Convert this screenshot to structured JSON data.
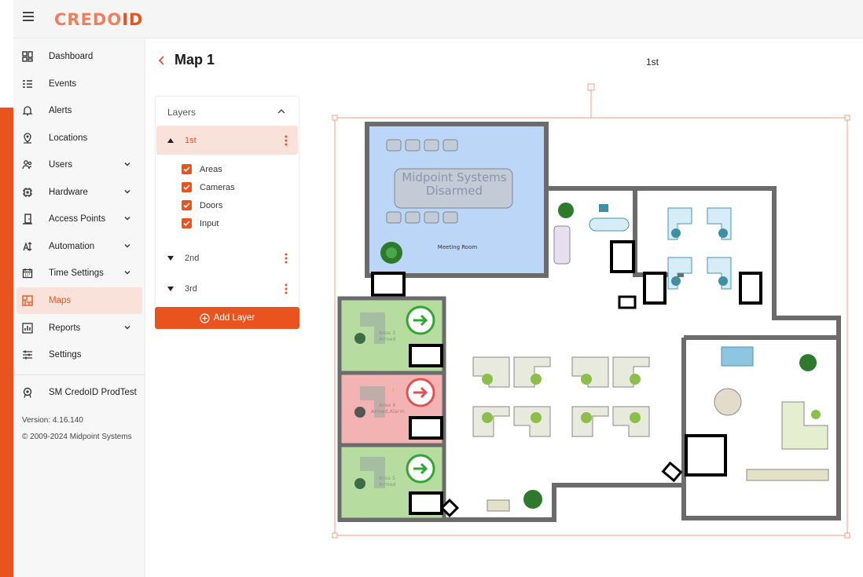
{
  "brand": {
    "logo_part1": "CREDO",
    "logo_part2": "ID"
  },
  "sidebar": {
    "items": [
      {
        "label": "Dashboard"
      },
      {
        "label": "Events"
      },
      {
        "label": "Alerts"
      },
      {
        "label": "Locations"
      },
      {
        "label": "Users"
      },
      {
        "label": "Hardware"
      },
      {
        "label": "Access Points"
      },
      {
        "label": "Automation"
      },
      {
        "label": "Time Settings"
      },
      {
        "label": "Maps"
      },
      {
        "label": "Reports"
      },
      {
        "label": "Settings"
      }
    ],
    "tenant": "SM CredoID ProdTest",
    "version": "Version: 4.16.140",
    "copyright": "© 2009-2024 Midpoint Systems"
  },
  "page": {
    "title": "Map 1"
  },
  "layers_panel": {
    "title": "Layers",
    "layers": [
      {
        "name": "1st"
      },
      {
        "name": "2nd"
      },
      {
        "name": "3rd"
      }
    ],
    "filters": [
      {
        "label": "Areas",
        "checked": true
      },
      {
        "label": "Cameras",
        "checked": true
      },
      {
        "label": "Doors",
        "checked": true
      },
      {
        "label": "Input",
        "checked": true
      }
    ],
    "add_button": "Add Layer"
  },
  "map": {
    "layer_label": "1st",
    "meeting_room": {
      "status_line1": "Midpoint Systems",
      "status_line2": "Disarmed",
      "room_label": "Meeting Room"
    },
    "areas": [
      {
        "line1": "Area 3",
        "line2": "Armed",
        "status": "armed"
      },
      {
        "line1": "Area 4",
        "line2": "Armed,Alarm",
        "status": "alarm"
      },
      {
        "line1": "Area 5",
        "line2": "Armed",
        "status": "armed"
      }
    ],
    "colors": {
      "armed_fill": "#b7dca0",
      "alarm_fill": "#f4b3b3",
      "disarmed_fill": "#bcd6f7",
      "armed_icon": "#2fa534",
      "alarm_icon": "#e05252",
      "wall": "#6b6b6b"
    }
  },
  "theme": {
    "accent": "#e9541e"
  }
}
